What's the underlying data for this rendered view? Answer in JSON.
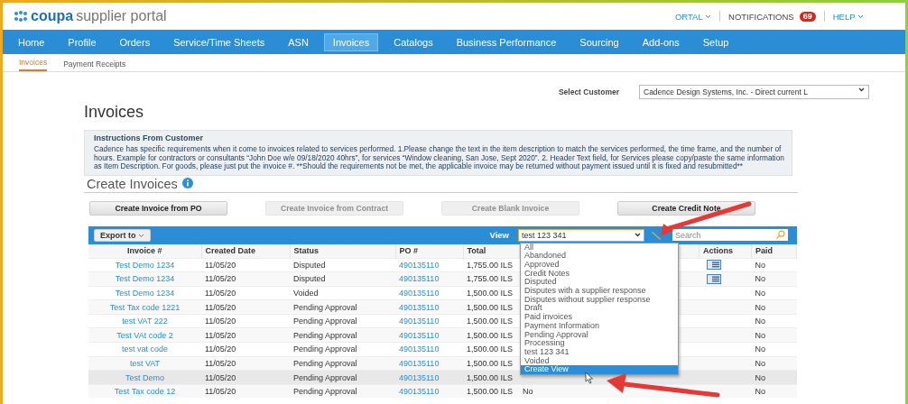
{
  "header": {
    "logo": "coupa",
    "product": "supplier portal",
    "user_menu": "ORTAL",
    "notifications": {
      "label": "NOTIFICATIONS",
      "count": "69"
    },
    "help": "HELP"
  },
  "nav": [
    {
      "label": "Home",
      "selected": false
    },
    {
      "label": "Profile",
      "selected": false
    },
    {
      "label": "Orders",
      "selected": false
    },
    {
      "label": "Service/Time Sheets",
      "selected": false
    },
    {
      "label": "ASN",
      "selected": false
    },
    {
      "label": "Invoices",
      "selected": true
    },
    {
      "label": "Catalogs",
      "selected": false
    },
    {
      "label": "Business Performance",
      "selected": false
    },
    {
      "label": "Sourcing",
      "selected": false
    },
    {
      "label": "Add-ons",
      "selected": false
    },
    {
      "label": "Setup",
      "selected": false
    }
  ],
  "subnav": [
    {
      "label": "Invoices",
      "selected": true
    },
    {
      "label": "Payment Receipts",
      "selected": false
    }
  ],
  "customer": {
    "label": "Select Customer",
    "value": "Cadence Design Systems, Inc. - Direct current L"
  },
  "title": "Invoices",
  "instructions": {
    "title": "Instructions From Customer",
    "text": "Cadence has specific requirements when it come to invoices related to services performed. 1.Please change the text in the item description to match the services performed, the time frame, and the number of hours. Example for contractors or consultants “John Doe w/e 09/18/2020 40hrs”, for services “Window cleaning, San Jose, Sept 2020”. 2. Header Text field, for Services please copy/paste the same information as Item Description. For goods, please just put the invoice #. **Should the requirements not be met, the applicable invoice may be returned without payment issued until it is fixed and resubmitted**"
  },
  "create": {
    "title": "Create Invoices",
    "buttons": [
      {
        "label": "Create Invoice from PO",
        "disabled": false
      },
      {
        "label": "Create Invoice from Contract",
        "disabled": true
      },
      {
        "label": "Create Blank Invoice",
        "disabled": true
      },
      {
        "label": "Create Credit Note",
        "disabled": false
      }
    ]
  },
  "table": {
    "export": "Export to",
    "view_label": "View",
    "view_value": "test 123 341",
    "search": {
      "placeholder": "Search"
    },
    "columns": [
      "Invoice #",
      "Created Date",
      "Status",
      "PO #",
      "Total",
      "Actions",
      "Paid"
    ],
    "rows": [
      {
        "invoice": "Test Demo 1234",
        "date": "11/05/20",
        "status": "Disputed",
        "po": "490135110",
        "total": "1,755.00 ILS",
        "has_actions": true,
        "paid": "No"
      },
      {
        "invoice": "Test Demo 1234",
        "date": "11/05/20",
        "status": "Disputed",
        "po": "490135110",
        "total": "1,755.00 ILS",
        "has_actions": true,
        "paid": "No"
      },
      {
        "invoice": "Test Demo 1234",
        "date": "11/05/20",
        "status": "Voided",
        "po": "490135110",
        "total": "1,500.00 ILS",
        "has_actions": false,
        "paid": "No"
      },
      {
        "invoice": "Test Tax code 1221",
        "date": "11/05/20",
        "status": "Pending Approval",
        "po": "490135110",
        "total": "1,500.00 ILS",
        "has_actions": false,
        "paid": "No"
      },
      {
        "invoice": "test VAT 222",
        "date": "11/05/20",
        "status": "Pending Approval",
        "po": "490135110",
        "total": "1,500.00 ILS",
        "has_actions": false,
        "paid": "No"
      },
      {
        "invoice": "Test VAt code 2",
        "date": "11/05/20",
        "status": "Pending Approval",
        "po": "490135110",
        "total": "1,500.00 ILS",
        "has_actions": false,
        "paid": "No"
      },
      {
        "invoice": "test vat code",
        "date": "11/05/20",
        "status": "Pending Approval",
        "po": "490135110",
        "total": "1,500.00 ILS",
        "has_actions": false,
        "paid": "No"
      },
      {
        "invoice": "test VAT",
        "date": "11/05/20",
        "status": "Pending Approval",
        "po": "490135110",
        "total": "1,500.00 ILS",
        "has_actions": false,
        "paid": "No"
      },
      {
        "invoice": "Test Demo",
        "date": "11/05/20",
        "status": "Pending Approval",
        "po": "490135110",
        "total": "1,500.00 ILS",
        "has_actions": false,
        "paid": "No"
      },
      {
        "invoice": "Test Tax code 12",
        "date": "11/05/20",
        "status": "Pending Approval",
        "po": "490135110",
        "total": "1,500.00 ILS",
        "column_6": "No",
        "has_actions": false,
        "paid": "No"
      }
    ],
    "view_options": [
      {
        "label": "All",
        "selected": false
      },
      {
        "label": "Abandoned",
        "selected": false
      },
      {
        "label": "Approved",
        "selected": false
      },
      {
        "label": "Credit Notes",
        "selected": false
      },
      {
        "label": "Disputed",
        "selected": false
      },
      {
        "label": "Disputes with a supplier response",
        "selected": false
      },
      {
        "label": "Disputes without supplier response",
        "selected": false
      },
      {
        "label": "Draft",
        "selected": false
      },
      {
        "label": "Paid invoices",
        "selected": false
      },
      {
        "label": "Payment Information",
        "selected": false
      },
      {
        "label": "Pending Approval",
        "selected": false
      },
      {
        "label": "Processing",
        "selected": false
      },
      {
        "label": "test 123 341",
        "selected": false
      },
      {
        "label": "Voided",
        "selected": false
      },
      {
        "label": "Create View",
        "selected": true
      }
    ]
  }
}
